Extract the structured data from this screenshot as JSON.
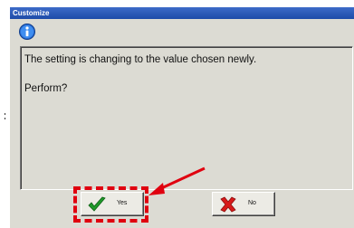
{
  "window": {
    "title": "Customize"
  },
  "message": {
    "line1": "The setting is changing to the value chosen newly.",
    "line2": "Perform?"
  },
  "buttons": {
    "yes_label": "Yes",
    "no_label": "No"
  },
  "icons": {
    "dialog": "info-icon",
    "yes": "checkmark-icon",
    "no": "x-mark-icon"
  },
  "colors": {
    "titlebar": "#1d4ba8",
    "highlight": "#e0000f",
    "dialog_bg": "#dcdbd3"
  }
}
